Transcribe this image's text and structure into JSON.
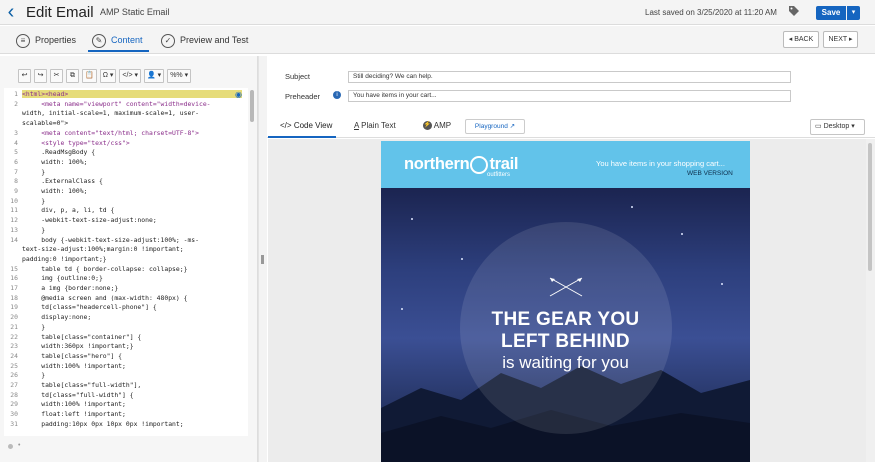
{
  "header": {
    "title": "Edit Email",
    "subtitle": "AMP Static Email",
    "last_saved": "Last saved on 3/25/2020 at 11:20 AM",
    "save_label": "Save",
    "back_icon": "chevron-left-icon",
    "tag_icon": "tag-icon",
    "dropdown_icon": "caret-down-icon"
  },
  "steps": {
    "properties": "Properties",
    "content": "Content",
    "preview": "Preview and Test",
    "back": "◂ BACK",
    "next": "NEXT ▸"
  },
  "toolbar": {
    "undo": "↩",
    "redo": "↪",
    "cut": "✂",
    "copy": "⧉",
    "paste": "📋",
    "omega": "Ω ▾",
    "code": "</> ▾",
    "person": "👤 ▾",
    "percent": "%% ▾"
  },
  "code": [
    {
      "n": "1",
      "t": "<html><head>"
    },
    {
      "n": "2",
      "t": "     <meta name=\"viewport\" content=\"width=device-"
    },
    {
      "n": "",
      "t": "width, initial-scale=1, maximum-scale=1, user-"
    },
    {
      "n": "",
      "t": "scalable=0\">"
    },
    {
      "n": "3",
      "t": "     <meta content=\"text/html; charset=UTF-8\">"
    },
    {
      "n": "4",
      "t": "     <style type=\"text/css\">"
    },
    {
      "n": "5",
      "t": "     .ReadMsgBody {"
    },
    {
      "n": "6",
      "t": "     width: 100%;"
    },
    {
      "n": "7",
      "t": "     }"
    },
    {
      "n": "8",
      "t": "     .ExternalClass {"
    },
    {
      "n": "9",
      "t": "     width: 100%;"
    },
    {
      "n": "10",
      "t": "     }"
    },
    {
      "n": "11",
      "t": "     div, p, a, li, td {"
    },
    {
      "n": "12",
      "t": "     -webkit-text-size-adjust:none;"
    },
    {
      "n": "13",
      "t": "     }"
    },
    {
      "n": "14",
      "t": "     body {-webkit-text-size-adjust:100%; -ms-"
    },
    {
      "n": "",
      "t": "text-size-adjust:100%;margin:0 !important;"
    },
    {
      "n": "",
      "t": "padding:0 !important;}"
    },
    {
      "n": "15",
      "t": "     table td { border-collapse: collapse;}"
    },
    {
      "n": "16",
      "t": "     img {outline:0;}"
    },
    {
      "n": "17",
      "t": "     a img {border:none;}"
    },
    {
      "n": "18",
      "t": "     @media screen and (max-width: 480px) {"
    },
    {
      "n": "19",
      "t": "     td[class=\"headercell-phone\"] {"
    },
    {
      "n": "20",
      "t": "     display:none;"
    },
    {
      "n": "21",
      "t": "     }"
    },
    {
      "n": "22",
      "t": "     table[class=\"container\"] {"
    },
    {
      "n": "23",
      "t": "     width:360px !important;}"
    },
    {
      "n": "24",
      "t": "     table[class=\"hero\"] {"
    },
    {
      "n": "25",
      "t": "     width:100% !important;"
    },
    {
      "n": "26",
      "t": "     }"
    },
    {
      "n": "27",
      "t": "     table[class=\"full-width\"],"
    },
    {
      "n": "28",
      "t": "     td[class=\"full-width\"] {"
    },
    {
      "n": "29",
      "t": "     width:100% !important;"
    },
    {
      "n": "30",
      "t": "     float:left !important;"
    },
    {
      "n": "31",
      "t": "     padding:10px 0px 10px 0px !important;"
    }
  ],
  "fields": {
    "subject_label": "Subject",
    "subject_value": "Still deciding? We can help.",
    "preheader_label": "Preheader",
    "preheader_value": "You have items in your cart...",
    "info_icon": "info-icon"
  },
  "view_tabs": {
    "code_view": "Code View",
    "plain_text": "Plain Text",
    "amp": "AMP",
    "playground": "Playground",
    "device": "Desktop"
  },
  "email": {
    "brand_a": "northern",
    "brand_b": "trail",
    "brand_sub": "outfitters",
    "cart_text": "You have items in your shopping cart...",
    "web_version": "WEB VERSION",
    "hero_line1": "THE GEAR YOU",
    "hero_line2": "LEFT BEHIND",
    "hero_line3": "is waiting for you"
  },
  "colors": {
    "accent": "#1565c0",
    "email_header": "#62c3ea"
  }
}
